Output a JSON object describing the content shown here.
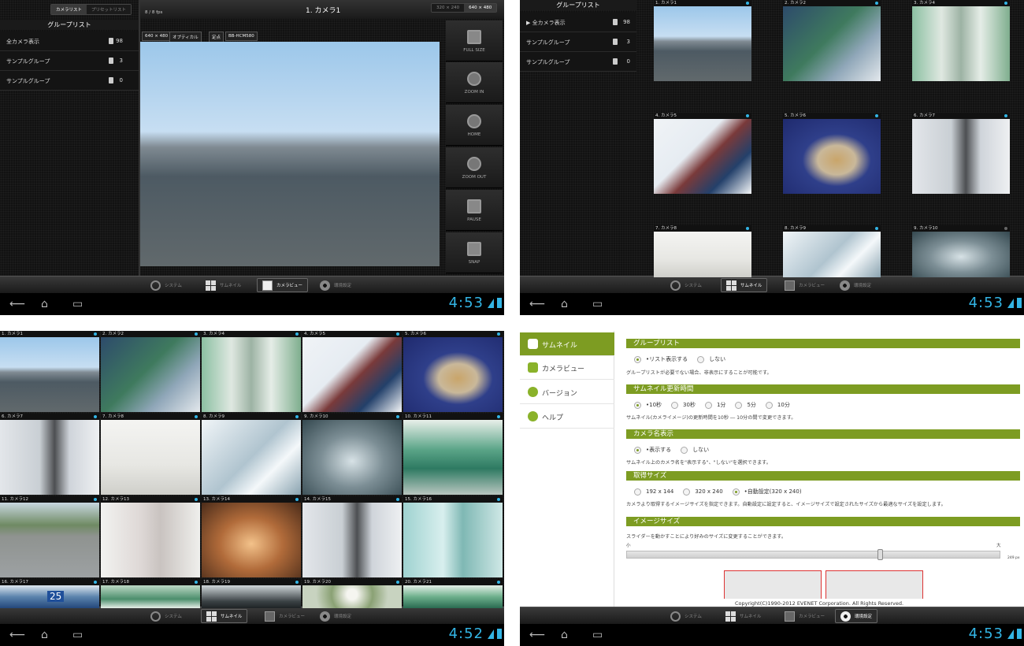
{
  "q1": {
    "seg_left": [
      "カメラリスト",
      "プリセットリスト"
    ],
    "group_header": "グループリスト",
    "groups": [
      {
        "name": "全カメラ表示",
        "count": "98"
      },
      {
        "name": "サンプルグループ",
        "count": "3"
      },
      {
        "name": "サンプルグループ",
        "count": "0"
      }
    ],
    "fps": "8 / 8  fps",
    "title": "1. カメラ1",
    "res_options": [
      "320 × 240",
      "640 × 480"
    ],
    "chips": [
      "640 × 480",
      "オプティカル",
      "定点",
      "BB-HCM580"
    ],
    "side_buttons": [
      "FULL SIZE",
      "ZOOM IN",
      "HOME",
      "ZOOM OUT",
      "PAUSE",
      "SNAP"
    ],
    "tabs": [
      "システム",
      "サムネイル",
      "カメラビュー",
      "環境設定"
    ],
    "time": "4:53"
  },
  "q2": {
    "group_header": "グループリスト",
    "groups": [
      {
        "name": "▶ 全カメラ表示",
        "count": "98"
      },
      {
        "name": "サンプルグループ",
        "count": "3"
      },
      {
        "name": "サンプルグループ",
        "count": "0"
      }
    ],
    "cams": [
      "1. カメラ1",
      "2. カメラ2",
      "3. カメラ4",
      "4. カメラ5",
      "5. カメラ6",
      "6. カメラ7",
      "7. カメラ8",
      "8. カメラ9",
      "9. カメラ10",
      "10. カメラ11",
      "11. カメラ12",
      "12. カメラ13"
    ],
    "tabs": [
      "システム",
      "サムネイル",
      "カメラビュー",
      "環境設定"
    ],
    "time": "4:53"
  },
  "q3": {
    "cams": [
      "1. カメラ1",
      "2. カメラ2",
      "3. カメラ4",
      "4. カメラ5",
      "5. カメラ6",
      "6. カメラ7",
      "7. カメラ8",
      "8. カメラ9",
      "9. カメラ10",
      "10. カメラ11",
      "11. カメラ12",
      "12. カメラ13",
      "13. カメラ14",
      "14. カメラ15",
      "15. カメラ16",
      "16. カメラ17",
      "17. カメラ18",
      "18. カメラ19",
      "19. カメラ20",
      "20. カメラ21"
    ],
    "badge": "25",
    "tabs": [
      "システム",
      "サムネイル",
      "カメラビュー",
      "環境設定"
    ],
    "time": "4:52"
  },
  "q4": {
    "menu": [
      "サムネイル",
      "カメラビュー",
      "バージョン",
      "ヘルプ"
    ],
    "sec1": "グループリスト",
    "sec1_opts": [
      "•リスト表示する",
      "しない"
    ],
    "sec1_desc": "グループリストが必要でない場合、非表示にすることが可能です。",
    "sec2": "サムネイル更新時間",
    "sec2_opts": [
      "•10秒",
      "30秒",
      "1分",
      "5分",
      "10分"
    ],
    "sec2_desc": "サムネイル(カメライメージ)の更新時間を10秒 ― 10分の間で変更できます。",
    "sec3": "カメラ名表示",
    "sec3_opts": [
      "•表示する",
      "しない"
    ],
    "sec3_desc": "サムネイル上のカメラ名を\"表示する\"、\"しない\"を選択できます。",
    "sec4": "取得サイズ",
    "sec4_opts": [
      "192 x 144",
      "320 x 240",
      "•自動設定(320 x 240)"
    ],
    "sec4_desc": "カメラより取得するイメージサイズを指定できます。自動設定に設定すると、イメージサイズで設定されたサイズから最適なサイズを設定します。",
    "sec5": "イメージサイズ",
    "sec5_desc": "スライダーを動かすことにより好みのサイズに変更することができます。",
    "small": "小",
    "large": "大",
    "px": "249 px",
    "slider_value_fraction": 0.68,
    "copyright": "Copyright(C)1990-2012 EVENET Corporation. All Rights Reserved.",
    "tabs": [
      "システム",
      "サムネイル",
      "カメラビュー",
      "環境設定"
    ],
    "time": "4:53"
  }
}
